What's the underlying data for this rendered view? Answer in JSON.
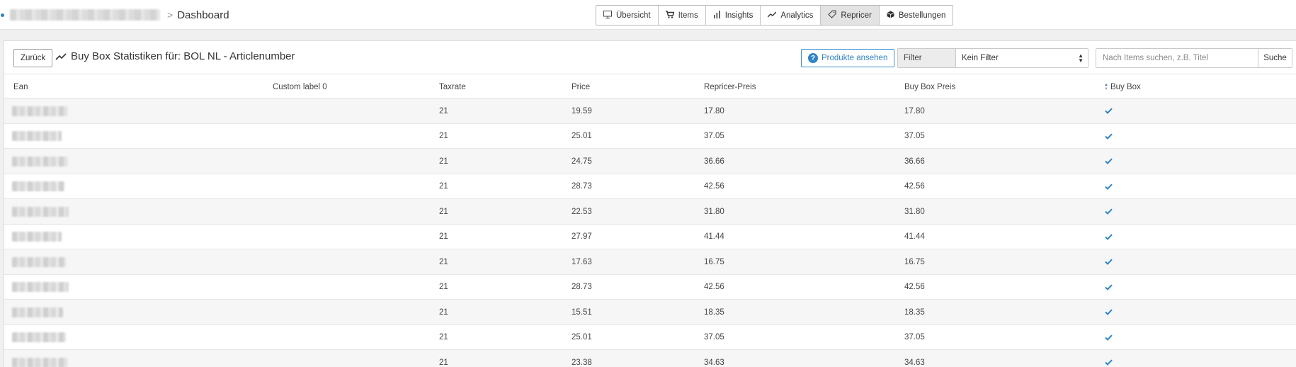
{
  "header": {
    "breadcrumb_current": "Dashboard",
    "breadcrumb_separator": ">",
    "nav": [
      {
        "label": "Übersicht",
        "icon": "monitor-icon",
        "active": false
      },
      {
        "label": "Items",
        "icon": "cart-icon",
        "active": false
      },
      {
        "label": "Insights",
        "icon": "bar-chart-icon",
        "active": false
      },
      {
        "label": "Analytics",
        "icon": "trend-icon",
        "active": false
      },
      {
        "label": "Repricer",
        "icon": "tag-icon",
        "active": true
      },
      {
        "label": "Bestellungen",
        "icon": "package-icon",
        "active": false
      }
    ]
  },
  "toolbar": {
    "back_label": "Zurück",
    "title": "Buy Box Statistiken für: BOL NL - Articlenumber",
    "products_label": "Produkte ansehen",
    "filter_label": "Filter",
    "filter_value": "Kein Filter",
    "search_placeholder": "Nach Items suchen, z.B. Titel",
    "search_button": "Suche"
  },
  "table": {
    "columns": [
      "Ean",
      "Custom label 0",
      "Taxrate",
      "Price",
      "Repricer-Preis",
      "Buy Box Preis",
      "Buy Box"
    ],
    "rows": [
      {
        "taxrate": "21",
        "price": "19.59",
        "repricer": "17.80",
        "buybox_price": "17.80",
        "buybox": true
      },
      {
        "taxrate": "21",
        "price": "25.01",
        "repricer": "37.05",
        "buybox_price": "37.05",
        "buybox": true
      },
      {
        "taxrate": "21",
        "price": "24.75",
        "repricer": "36.66",
        "buybox_price": "36.66",
        "buybox": true
      },
      {
        "taxrate": "21",
        "price": "28.73",
        "repricer": "42.56",
        "buybox_price": "42.56",
        "buybox": true
      },
      {
        "taxrate": "21",
        "price": "22.53",
        "repricer": "31.80",
        "buybox_price": "31.80",
        "buybox": true
      },
      {
        "taxrate": "21",
        "price": "27.97",
        "repricer": "41.44",
        "buybox_price": "41.44",
        "buybox": true
      },
      {
        "taxrate": "21",
        "price": "17.63",
        "repricer": "16.75",
        "buybox_price": "16.75",
        "buybox": true
      },
      {
        "taxrate": "21",
        "price": "28.73",
        "repricer": "42.56",
        "buybox_price": "42.56",
        "buybox": true
      },
      {
        "taxrate": "21",
        "price": "15.51",
        "repricer": "18.35",
        "buybox_price": "18.35",
        "buybox": true
      },
      {
        "taxrate": "21",
        "price": "25.01",
        "repricer": "37.05",
        "buybox_price": "37.05",
        "buybox": true
      },
      {
        "taxrate": "21",
        "price": "23.38",
        "repricer": "34.63",
        "buybox_price": "34.63",
        "buybox": true
      }
    ]
  },
  "colors": {
    "accent": "#2f84c7",
    "active_tab": "#e3e3e3"
  }
}
